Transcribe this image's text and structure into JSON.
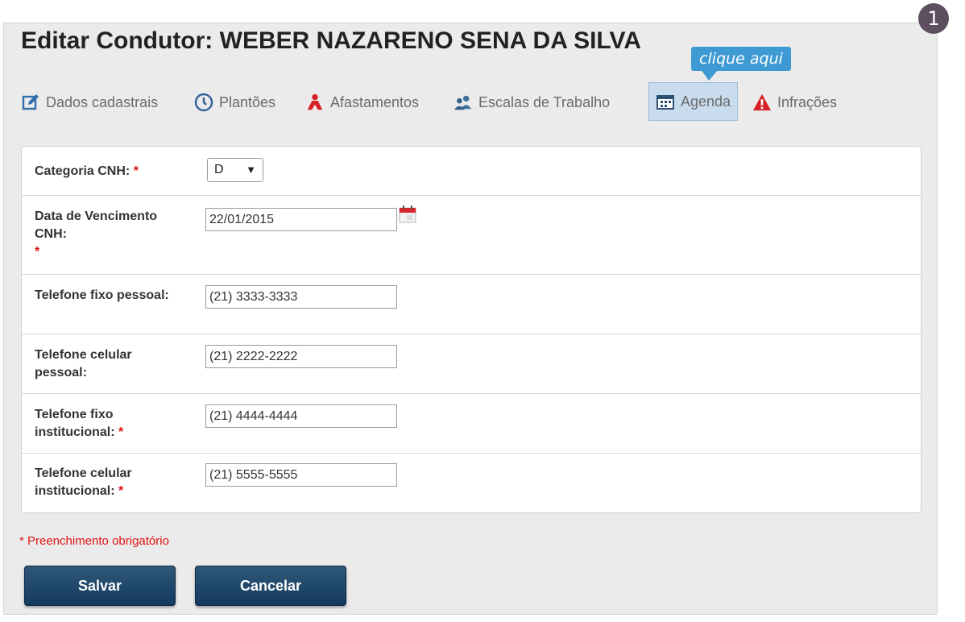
{
  "step_number": "1",
  "page": {
    "title": "Editar Condutor: WEBER NAZARENO SENA DA SILVA"
  },
  "tooltip": {
    "text": "clique aqui"
  },
  "tabs": [
    {
      "label": "Dados cadastrais",
      "icon": "edit-icon"
    },
    {
      "label": "Plantões",
      "icon": "clock-icon"
    },
    {
      "label": "Afastamentos",
      "icon": "person-leave-icon"
    },
    {
      "label": "Escalas de Trabalho",
      "icon": "users-icon"
    },
    {
      "label": "Agenda",
      "icon": "calendar-icon",
      "active": true
    },
    {
      "label": "Infrações",
      "icon": "warning-icon"
    }
  ],
  "form": {
    "required_mark": "*",
    "categoria": {
      "label": "Categoria CNH:",
      "value": "D",
      "arrow": "▼"
    },
    "vencimento": {
      "label": "Data de Vencimento CNH:",
      "value": "22/01/2015"
    },
    "fixo_pessoal": {
      "label": "Telefone fixo pessoal:",
      "value": "(21) 3333-3333"
    },
    "celular_pessoal": {
      "label": "Telefone celular pessoal:",
      "value": "(21) 2222-2222"
    },
    "fixo_institucional": {
      "label": "Telefone fixo institucional:",
      "value": "(21) 4444-4444"
    },
    "celular_institucional": {
      "label": "Telefone celular institucional:",
      "value": "(21) 5555-5555"
    }
  },
  "required_note": "* Preenchimento obrigatório",
  "buttons": {
    "save": "Salvar",
    "cancel": "Cancelar"
  },
  "colors": {
    "accent": "#3d9ad2",
    "button": "#133a5d",
    "required": "#e01515",
    "active_tab": "#c9dcee",
    "step_badge": "#5d4e60"
  }
}
